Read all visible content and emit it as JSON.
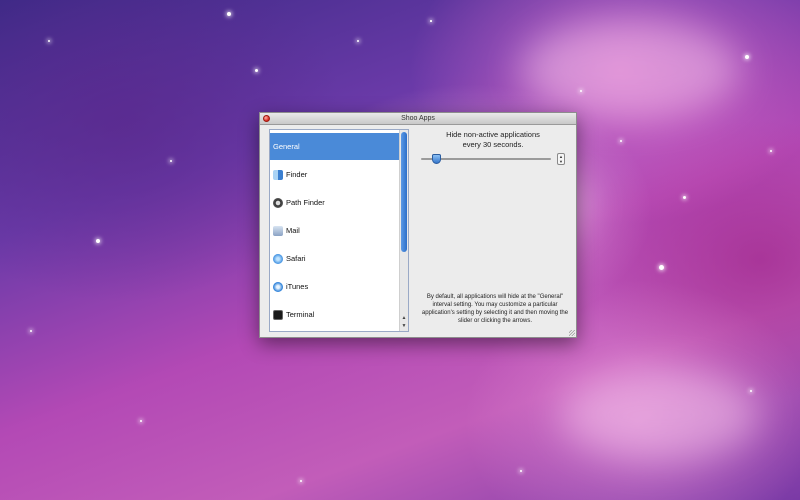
{
  "window": {
    "title": "Shoo Apps"
  },
  "app_list": {
    "items": [
      {
        "label": "General",
        "icon": null,
        "selected": true
      },
      {
        "label": "Finder",
        "icon": "finder-icon",
        "selected": false
      },
      {
        "label": "Path Finder",
        "icon": "path-finder-icon",
        "selected": false
      },
      {
        "label": "Mail",
        "icon": "mail-icon",
        "selected": false
      },
      {
        "label": "Safari",
        "icon": "safari-icon",
        "selected": false
      },
      {
        "label": "iTunes",
        "icon": "itunes-icon",
        "selected": false
      },
      {
        "label": "Terminal",
        "icon": "terminal-icon",
        "selected": false
      }
    ]
  },
  "settings": {
    "hide_line1": "Hide non-active applications",
    "hide_line2": "every 30 seconds.",
    "interval_seconds": 30,
    "info_text": "By default, all applications will hide at the \"General\" interval setting.  You may customize a particular application's setting by selecting it and then moving the slider or clicking the arrows."
  },
  "colors": {
    "selection": "#4a8ad8",
    "accent": "#3677cc"
  }
}
